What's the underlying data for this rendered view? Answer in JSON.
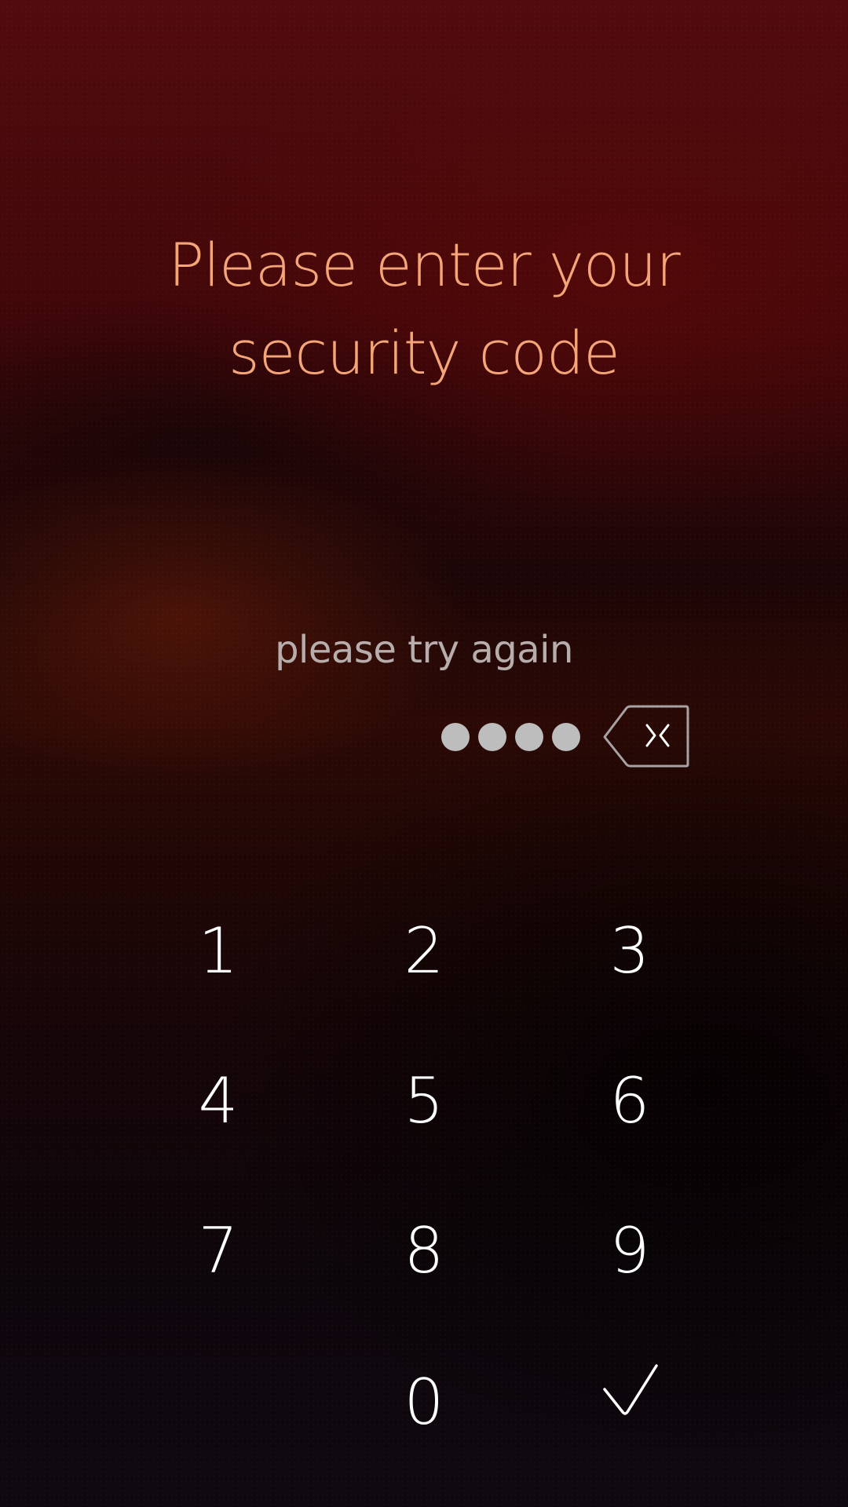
{
  "prompt": {
    "line1": "Please enter your",
    "line2": "security code"
  },
  "status": "please try again",
  "entered_digits": 4,
  "colors": {
    "title": "#f4a678",
    "status": "#b7adac",
    "dots": "#bdbdbd",
    "keys": "#ffffff"
  },
  "keypad": {
    "keys": [
      "1",
      "2",
      "3",
      "4",
      "5",
      "6",
      "7",
      "8",
      "9",
      "0"
    ],
    "backspace_icon": "backspace-icon",
    "confirm_icon": "checkmark-icon"
  }
}
